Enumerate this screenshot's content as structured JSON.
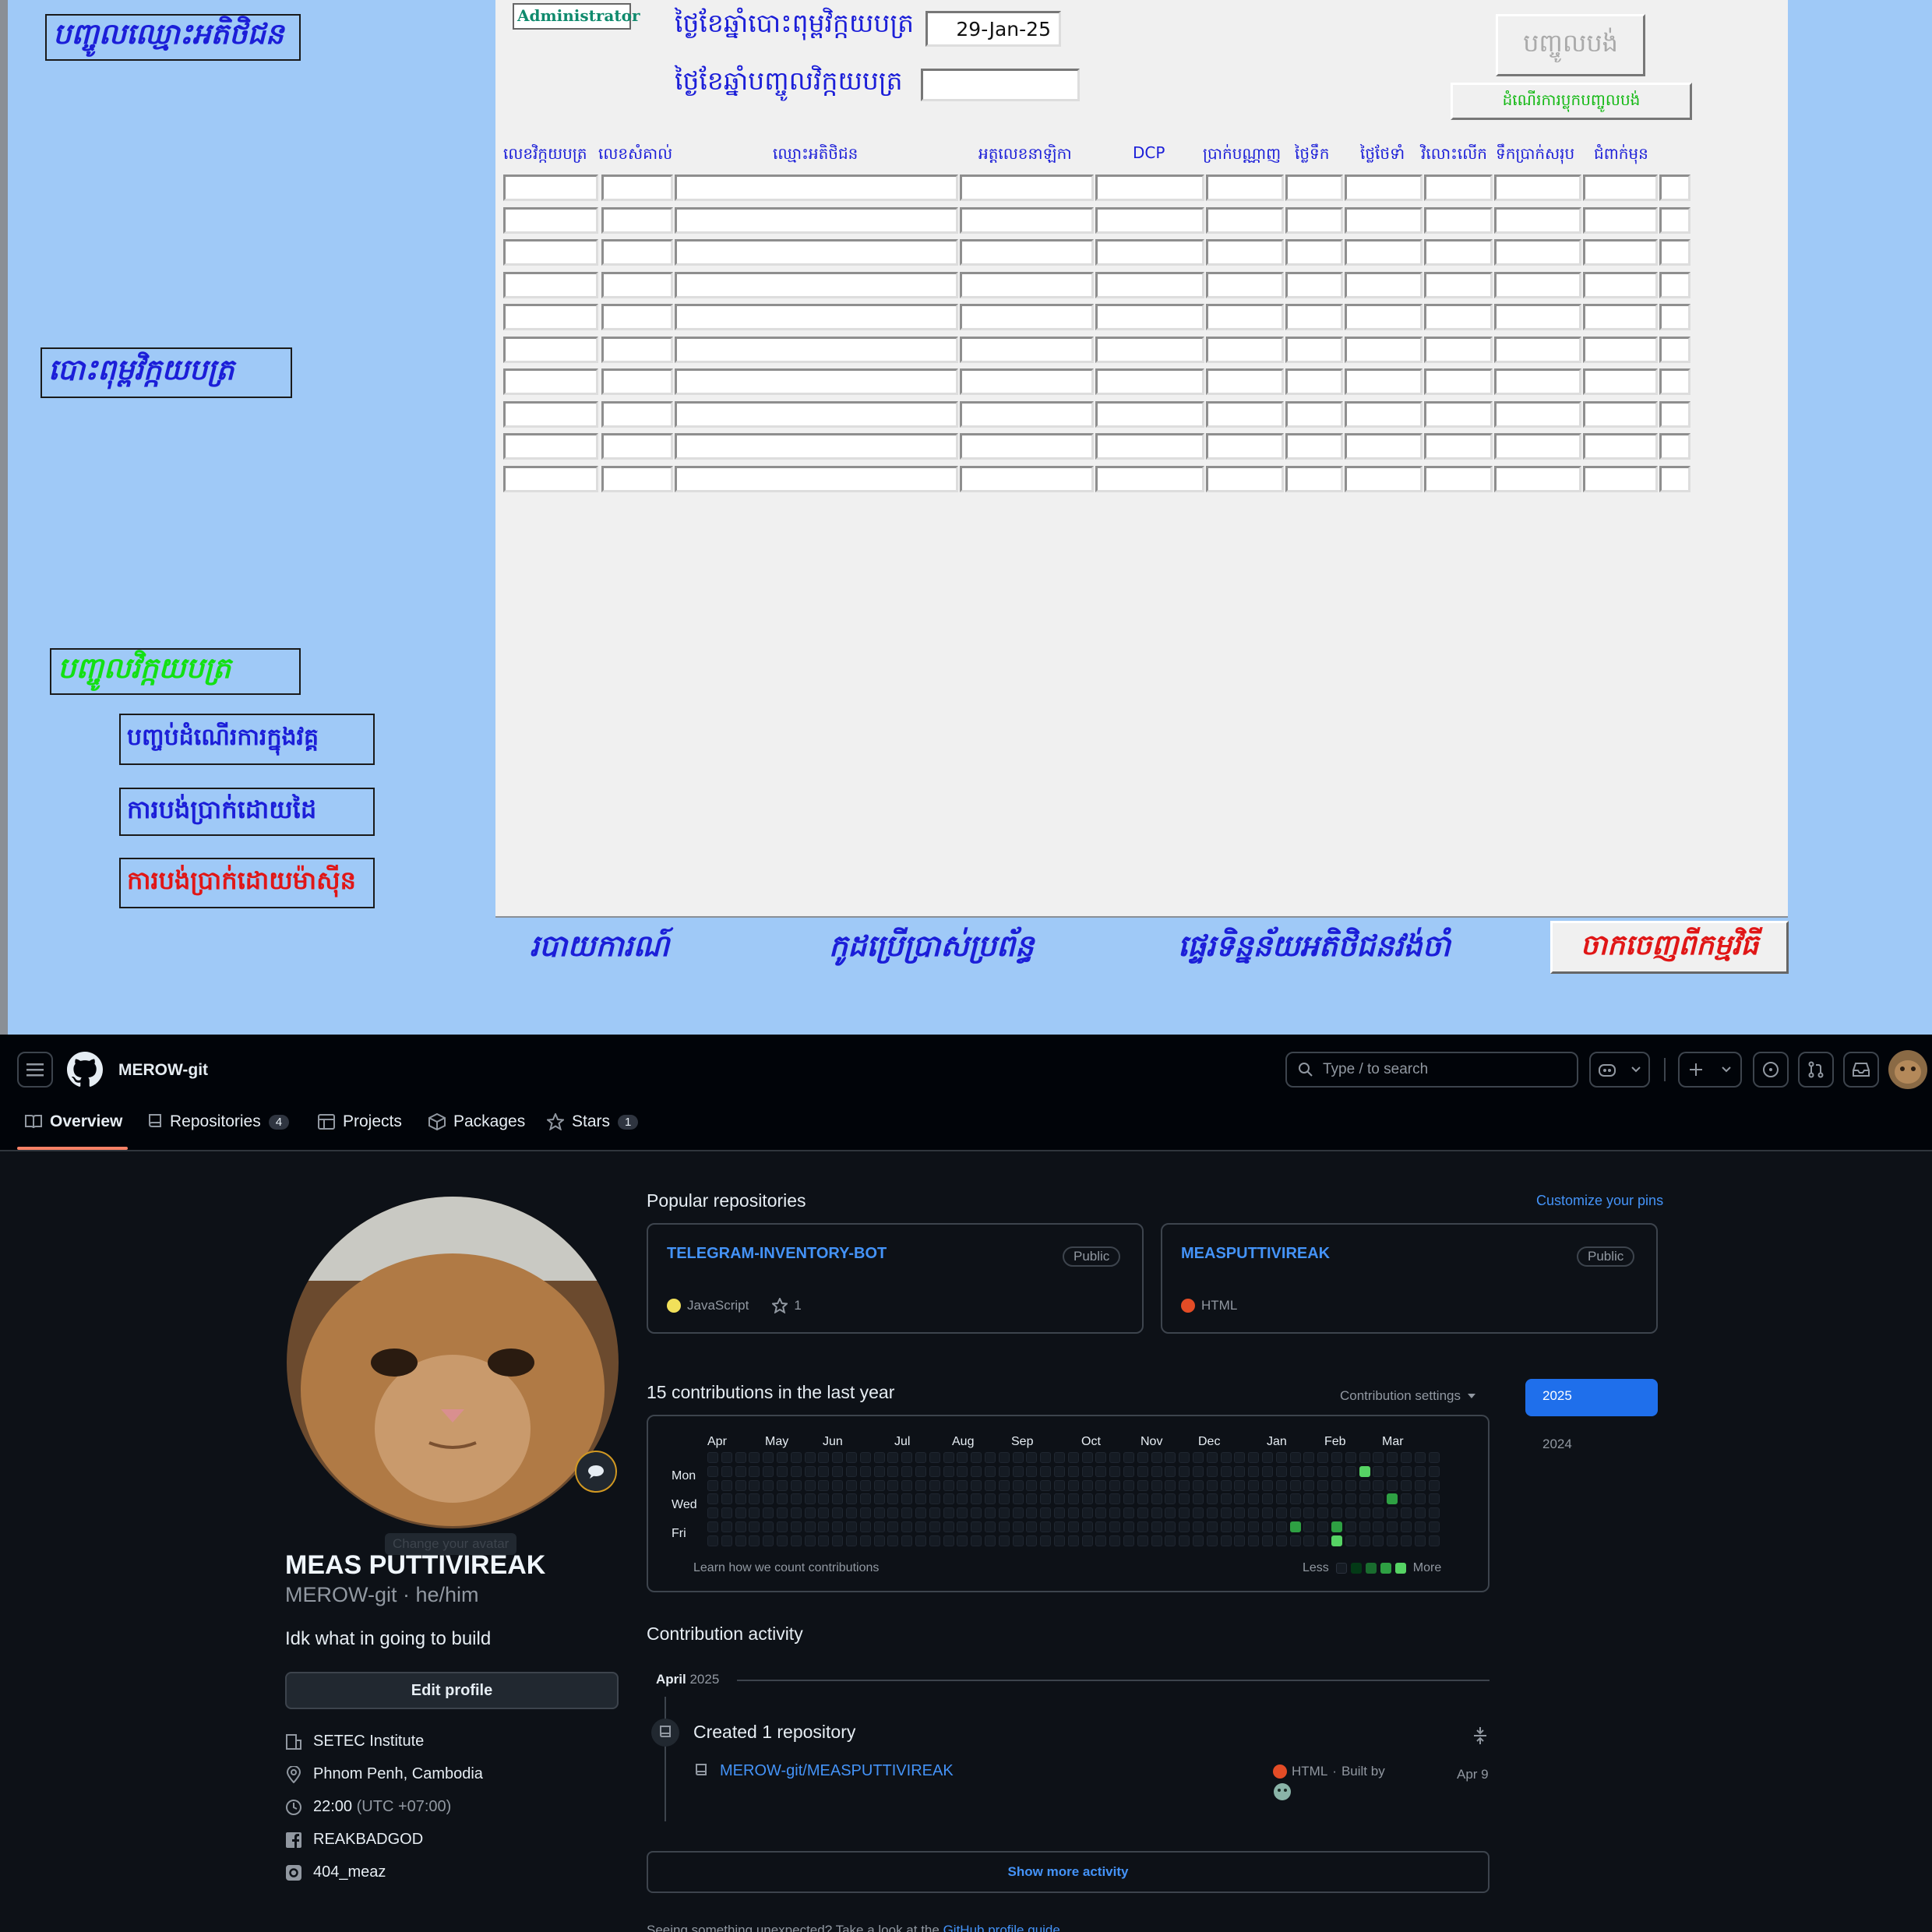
{
  "access_form": {
    "left_nav": {
      "enter_guest_name": "បញ្ចូលឈ្មោះអតិថិជន",
      "print_invoice": "បោះពុម្ពវិក្កយបត្រ",
      "enter_invoice": "បញ្ចូលវិក្កយបត្រ",
      "end_inroom_process": "បញ្ចប់ដំណើរការក្នុងវគ្គ",
      "pay_by_hand": "ការបង់ប្រាក់ដោយដៃ",
      "pay_by_machine": "ការបង់ប្រាក់ដោយម៉ាស៊ីន"
    },
    "user_badge": "Administrator",
    "print_date_label": "ថ្ងៃខែឆ្នាំបោះពុម្ពវិក្កយបត្រ",
    "print_date_value": "29-Jan-25",
    "enter_date_label": "ថ្ងៃខែឆ្នាំបញ្ចូលវិក្កយបត្រ",
    "enter_date_value": "",
    "submit_button": "បញ្ចូលបង់",
    "process_button": "ដំណើរការប្លុកបញ្ចូលបង់",
    "columns": [
      "លេខវិក្កយបត្រ",
      "លេខសំគាល់",
      "ឈ្មោះអតិថិជន",
      "អត្តលេខនាឡិកា",
      "DCP",
      "ប្រាក់បណ្ណាញ",
      "ថ្លៃទឹក",
      "ថ្លៃថែទាំ",
      "វិលោះលើក",
      "ទឹកប្រាក់សរុប",
      "ជំពាក់មុន"
    ],
    "bottom_nav": {
      "report": "របាយការណ៍",
      "user_code": "កូដប្រើប្រាស់ប្រព័ន្ធ",
      "transfer_data": "ផ្ទេរទិន្នន័យអតិថិជនវង់ចាំ",
      "exit": "ចាកចេញពីកម្មវិធី"
    }
  },
  "github": {
    "username": "MEROW-git",
    "search_placeholder": "Type / to search",
    "tabs": [
      {
        "label": "Overview",
        "count": ""
      },
      {
        "label": "Repositories",
        "count": "4"
      },
      {
        "label": "Projects",
        "count": ""
      },
      {
        "label": "Packages",
        "count": ""
      },
      {
        "label": "Stars",
        "count": "1"
      }
    ],
    "profile": {
      "change_avatar": "Change your avatar",
      "full_name": "MEAS PUTTIVIREAK",
      "handle_line": "MEROW-git · he/him",
      "bio": "Idk what in going to build",
      "edit_button": "Edit profile",
      "org": "SETEC Institute",
      "location": "Phnom Penh, Cambodia",
      "time": "22:00",
      "timezone": "(UTC +07:00)",
      "facebook": "REAKBADGOD",
      "instagram": "404_meaz"
    },
    "popular": {
      "heading": "Popular repositories",
      "customize": "Customize your pins",
      "repos": [
        {
          "name": "TELEGRAM-INVENTORY-BOT",
          "badge": "Public",
          "lang": "JavaScript",
          "lang_color": "#f1e05a",
          "stars": "1"
        },
        {
          "name": "MEASPUTTIVIREAK",
          "badge": "Public",
          "lang": "HTML",
          "lang_color": "#e34c26",
          "stars": ""
        }
      ]
    },
    "contrib": {
      "heading": "15 contributions in the last year",
      "settings": "Contribution settings",
      "months": [
        "Apr",
        "May",
        "Jun",
        "Jul",
        "Aug",
        "Sep",
        "Oct",
        "Nov",
        "Dec",
        "Jan",
        "Feb",
        "Mar"
      ],
      "days": [
        "Mon",
        "Wed",
        "Fri"
      ],
      "learn": "Learn how we count contributions",
      "less": "Less",
      "more": "More",
      "years": [
        "2025",
        "2024"
      ]
    },
    "activity": {
      "heading": "Contribution activity",
      "month": "April",
      "year": "2025",
      "event": "Created 1 repository",
      "repo": "MEROW-git/MEASPUTTIVIREAK",
      "lang": "HTML",
      "built_by": "Built by",
      "date": "Apr 9",
      "show_more": "Show more activity",
      "footer_prefix": "Seeing something unexpected? Take a look at the ",
      "footer_link": "GitHub profile guide"
    }
  }
}
